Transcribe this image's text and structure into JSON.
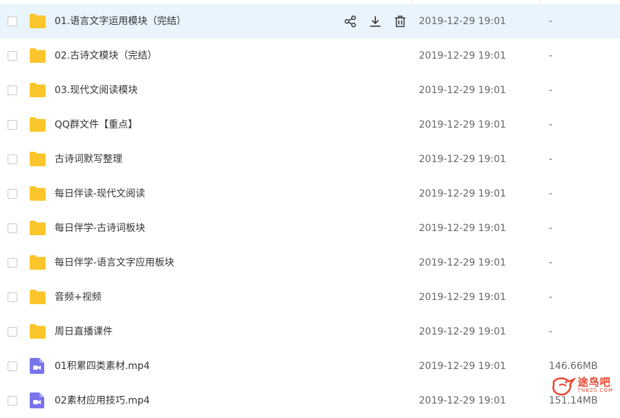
{
  "actions": {
    "share_icon": "share-icon",
    "download_icon": "download-icon",
    "delete_icon": "trash-icon"
  },
  "colors": {
    "folder": "#f9c52b",
    "video": "#7b73ec",
    "hover_row": "#e9f4fd"
  },
  "files": [
    {
      "name": "01.语言文字运用模块（完结）",
      "date": "2019-12-29 19:01",
      "size": "-",
      "type": "folder"
    },
    {
      "name": "02.古诗文模块（完结）",
      "date": "2019-12-29 19:01",
      "size": "-",
      "type": "folder"
    },
    {
      "name": "03.现代文阅读模块",
      "date": "2019-12-29 19:01",
      "size": "-",
      "type": "folder"
    },
    {
      "name": "QQ群文件【重点】",
      "date": "2019-12-29 19:01",
      "size": "-",
      "type": "folder"
    },
    {
      "name": "古诗词默写整理",
      "date": "2019-12-29 19:01",
      "size": "-",
      "type": "folder"
    },
    {
      "name": "每日伴读-现代文阅读",
      "date": "2019-12-29 19:01",
      "size": "-",
      "type": "folder"
    },
    {
      "name": "每日伴学-古诗词板块",
      "date": "2019-12-29 19:01",
      "size": "-",
      "type": "folder"
    },
    {
      "name": "每日伴学-语言文字应用板块",
      "date": "2019-12-29 19:01",
      "size": "-",
      "type": "folder"
    },
    {
      "name": "音频+视频",
      "date": "2019-12-29 19:01",
      "size": "-",
      "type": "folder"
    },
    {
      "name": "周日直播课件",
      "date": "2019-12-29 19:01",
      "size": "-",
      "type": "folder"
    },
    {
      "name": "01积累四类素材.mp4",
      "date": "2019-12-29 19:01",
      "size": "146.66MB",
      "type": "video"
    },
    {
      "name": "02素材应用技巧.mp4",
      "date": "2019-12-29 19:01",
      "size": "151.14MB",
      "type": "video"
    }
  ],
  "watermark": {
    "main": "途鸟吧",
    "sub": "TNBZS.COM"
  }
}
